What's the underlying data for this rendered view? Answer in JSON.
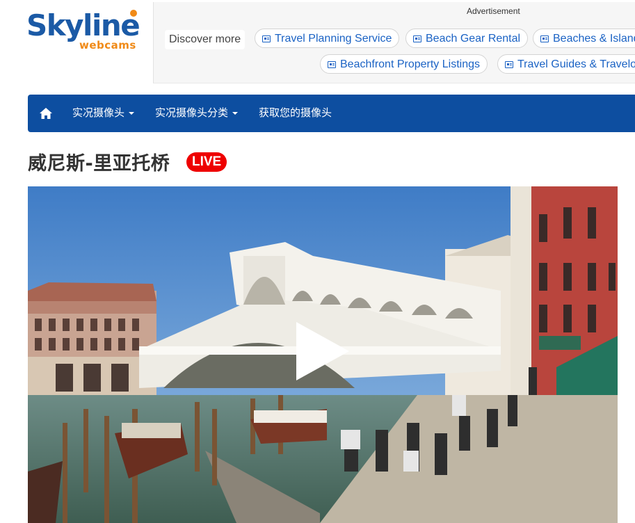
{
  "logo": {
    "main": "Skyline",
    "sub": "webcams"
  },
  "ad": {
    "label": "Advertisement",
    "discover": "Discover more",
    "chips": [
      "Travel Planning Service",
      "Beach Gear Rental",
      "Beaches & Islands",
      "Beachfront Property Listings",
      "Travel Guides & Travelogues"
    ]
  },
  "nav": {
    "items": [
      "实况摄像头",
      "实况摄像头分类",
      "获取您的摄像头"
    ]
  },
  "page": {
    "title": "威尼斯-里亚托桥",
    "live_badge": "LIVE"
  },
  "colors": {
    "brand_blue": "#1b5aa6",
    "brand_orange": "#f08a17",
    "nav_bg": "#0d4ea0",
    "live_red": "#ee0000",
    "link_blue": "#1a62c4"
  }
}
